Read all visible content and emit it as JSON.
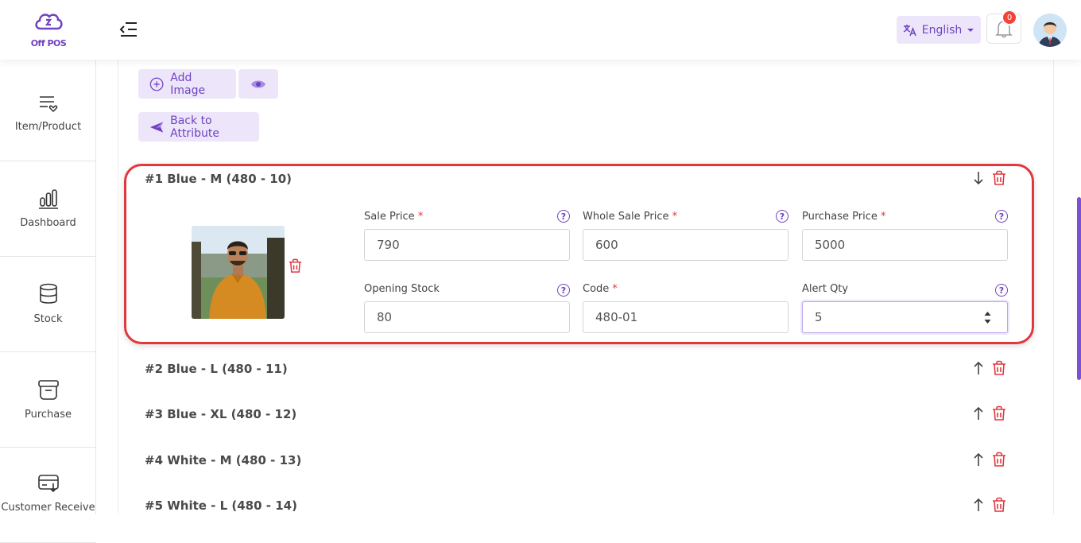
{
  "brand": {
    "logo_text": "Off POS"
  },
  "header": {
    "language": "English",
    "notification_count": "0"
  },
  "sidebar": {
    "items": [
      {
        "label": "Item/Product",
        "icon": "item-product-icon"
      },
      {
        "label": "Dashboard",
        "icon": "dashboard-icon"
      },
      {
        "label": "Stock",
        "icon": "stock-icon"
      },
      {
        "label": "Purchase",
        "icon": "purchase-icon"
      },
      {
        "label": "Customer Receive",
        "icon": "customer-receive-icon"
      }
    ]
  },
  "toolbar": {
    "add_image": "Add Image",
    "back_to_attribute": "Back to Attribute"
  },
  "variants": [
    {
      "title": "#1 Blue - M (480 - 10)",
      "expanded": true,
      "fields": {
        "sale_price": {
          "label": "Sale Price",
          "value": "790",
          "required": true
        },
        "whole_sale_price": {
          "label": "Whole Sale Price",
          "value": "600",
          "required": true
        },
        "purchase_price": {
          "label": "Purchase Price",
          "value": "5000",
          "required": true
        },
        "opening_stock": {
          "label": "Opening Stock",
          "value": "80",
          "required": false
        },
        "code": {
          "label": "Code",
          "value": "480-01",
          "required": true
        },
        "alert_qty": {
          "label": "Alert Qty",
          "value": "5",
          "required": false
        }
      }
    },
    {
      "title": "#2 Blue - L (480 - 11)",
      "expanded": false
    },
    {
      "title": "#3 Blue - XL (480 - 12)",
      "expanded": false
    },
    {
      "title": "#4 White - M (480 - 13)",
      "expanded": false
    },
    {
      "title": "#5 White - L (480 - 14)",
      "expanded": false
    }
  ],
  "colors": {
    "accent": "#6f42c1",
    "accent_soft": "#ede6fb",
    "danger": "#e0383e",
    "highlight_border": "#e0383e"
  }
}
